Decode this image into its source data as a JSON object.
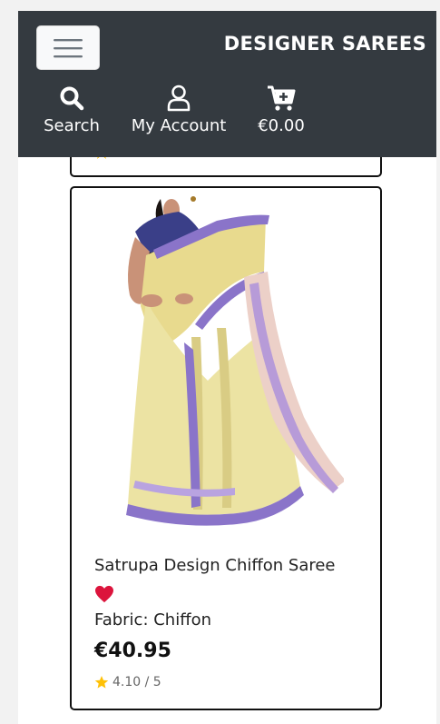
{
  "header": {
    "brand": "DESIGNER SAREES",
    "menu_icon": "hamburger-icon",
    "nav": [
      {
        "label": "Search",
        "icon": "search-icon"
      },
      {
        "label": "My Account",
        "icon": "user-icon"
      },
      {
        "label": "€0.00",
        "icon": "cart-plus-icon"
      }
    ]
  },
  "product": {
    "title": "Satrupa Design Chiffon Saree",
    "fabric": "Fabric: Chiffon",
    "price": "€40.95",
    "rating": "4.10 / 5",
    "favorite_icon": "heart-icon",
    "rating_icon": "star-icon"
  },
  "colors": {
    "header_bg": "#343a40",
    "heart": "#dc143c",
    "star": "#ffc107"
  }
}
